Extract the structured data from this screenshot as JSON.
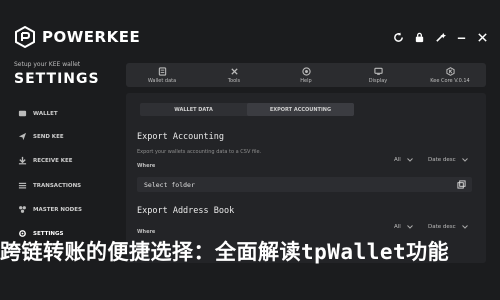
{
  "app": {
    "brand": "POWERKEE",
    "setup_sub": "Setup your KEE wallet",
    "setup_title": "SETTINGS"
  },
  "sidebar": {
    "items": [
      {
        "label": "WALLET",
        "icon": "wallet-icon"
      },
      {
        "label": "SEND KEE",
        "icon": "send-icon"
      },
      {
        "label": "RECEIVE KEE",
        "icon": "receive-icon"
      },
      {
        "label": "TRANSACTIONS",
        "icon": "transactions-icon"
      },
      {
        "label": "MASTER NODES",
        "icon": "masternodes-icon"
      },
      {
        "label": "SETTINGS",
        "icon": "gear-icon"
      }
    ]
  },
  "tabs": [
    {
      "label": "Wallet data",
      "icon": "wallet-data-icon"
    },
    {
      "label": "Tools",
      "icon": "tools-icon"
    },
    {
      "label": "Help",
      "icon": "help-icon"
    },
    {
      "label": "Display",
      "icon": "display-icon"
    },
    {
      "label": "Kee Core V.0.14",
      "icon": "kee-core-icon"
    }
  ],
  "segments": {
    "left": "WALLET DATA",
    "right": "EXPORT ACCOUNTING"
  },
  "export_accounting": {
    "title": "Export Accounting",
    "desc": "Export your wallets accounting data to a CSV file.",
    "where": "Where",
    "filter_all": "All",
    "filter_date": "Date desc",
    "folder": "Select folder"
  },
  "export_address": {
    "title": "Export Address Book",
    "where": "Where",
    "filter_all": "All",
    "filter_date": "Date desc"
  },
  "overlay_text": "跨链转账的便捷选择：全面解读tpWallet功能"
}
